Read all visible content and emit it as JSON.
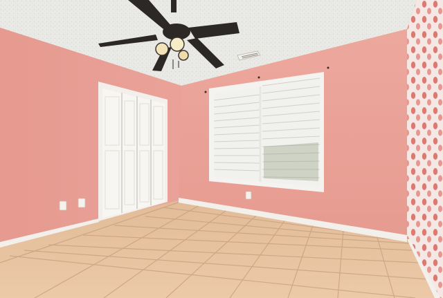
{
  "scene": {
    "kind": "photo-empty-bedroom",
    "colors": {
      "wall_left": "#e9a199",
      "wall_back": "#eba59b",
      "ceiling": "#e9e9e6",
      "floor": "#e8c3a0",
      "grout": "#c9a07f",
      "trim": "#f3f0ec",
      "door": "#f7f6f3",
      "fan_blade": "#2b2826",
      "window_blind": "#f1f1ee",
      "wallpaper_base": "#f4e7e4",
      "wallpaper_motif": "#d9675e"
    },
    "icons": [
      "ceiling-fan-icon",
      "light-bulb-icon",
      "air-vent-icon",
      "power-outlet-icon",
      "light-switch-icon"
    ]
  }
}
